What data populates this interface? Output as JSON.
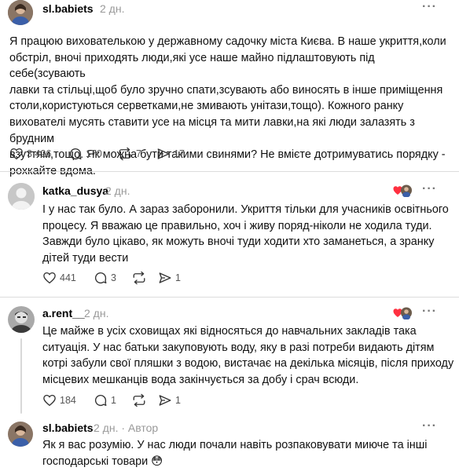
{
  "posts": [
    {
      "username": "sl.babiets",
      "time": "2 дн.",
      "more": "···",
      "lines": [
        "Я працюю вихователькою у державному садочку міста Києва. В наше укриття,коли",
        "обстріл, вночі приходять люди,які усе наше майно підлаштовують під себе(зсувають",
        "лавки та стільці,щоб було зручно спати,зсувають або виносять в інше приміщення",
        "столи,користуються серветками,не змивають унітази,тощо). Кожного ранку",
        "вихователі мусять ставити усе на місця та мити лавки,на які люди залазять з брудним",
        "взуттям,тощо. Як можна бути такими свинями? Не вмієте дотримуватись порядку -",
        "рохкайте вдома."
      ],
      "likes": "3 426",
      "replies": "170",
      "reposts": "7",
      "shares": "17"
    },
    {
      "username": "katka_dusya",
      "time": "2 дн.",
      "more": "···",
      "lines": [
        "І у нас так було. А зараз заборонили. Укриття тільки для учасників освітнього",
        "процесу. Я вважаю це правильно, хоч і живу поряд-ніколи не ходила туди.",
        "Завжди було цікаво, як можуть вночі туди ходити хто заманеться, а зранку",
        "дітей туди вести"
      ],
      "likes": "441",
      "replies": "3",
      "reposts": "",
      "shares": "1"
    },
    {
      "username": "a.rent__",
      "time": "2 дн.",
      "more": "···",
      "lines": [
        "Це майже в усіх сховищах які відносяться до навчальних закладів така",
        "ситуація. У нас батьки закуповують воду, яку в разі потреби видають дітям",
        "котрі забули свої пляшки з водою, вистачає на декілька місяців, після приходу",
        "місцевих мешканців вода закінчується за добу і срач всюди."
      ],
      "likes": "184",
      "replies": "1",
      "reposts": "",
      "shares": "1"
    },
    {
      "username": "sl.babiets",
      "time": "2 дн.",
      "author_tag": "· Автор",
      "more": "···",
      "lines": [
        "Як я вас розумію. У нас люди почали навіть розпаковувати миюче та інші",
        "господарські товари 😳"
      ]
    }
  ],
  "colors": {
    "heart_red": "#ff3040",
    "muted": "#999999",
    "divider": "#dcdcdc"
  },
  "icons": [
    "heart-icon",
    "comment-icon",
    "repost-icon",
    "share-icon",
    "more-icon",
    "liked-by-author-icon"
  ]
}
